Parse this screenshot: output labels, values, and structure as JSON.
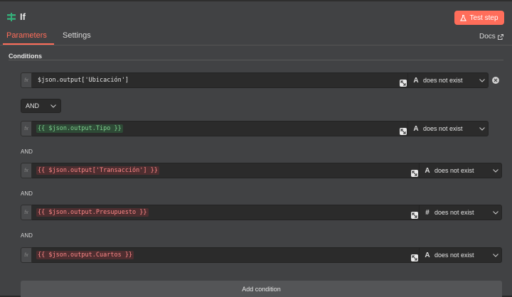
{
  "header": {
    "title": "If",
    "test_step_label": "Test step"
  },
  "tabs": [
    {
      "label": "Parameters",
      "active": true
    },
    {
      "label": "Settings",
      "active": false
    }
  ],
  "docs_label": "Docs",
  "section_title": "Conditions",
  "combinator": {
    "selected": "AND"
  },
  "and_label": "AND",
  "conditions": [
    {
      "expression": "$json.output['Ubicación']",
      "style": "plain",
      "type_icon": "A",
      "operator": "does not exist"
    },
    {
      "expression": "{{ $json.output.Tipo }}",
      "style": "resolved",
      "type_icon": "A",
      "operator": "does not exist"
    },
    {
      "expression": "{{ $json.output['Transacción'] }}",
      "style": "error",
      "type_icon": "A",
      "operator": "does not exist"
    },
    {
      "expression": "{{ $json.output.Presupuesto }}",
      "style": "error",
      "type_icon": "#",
      "operator": "does not exist"
    },
    {
      "expression": "{{ $json.output.Cuartos }}",
      "style": "error",
      "type_icon": "A",
      "operator": "does not exist"
    }
  ],
  "add_condition_label": "Add condition",
  "colors": {
    "accent": "#ff6d5a",
    "panel": "#414244",
    "input_bg": "#2b2b2b",
    "resolved_text": "#7fd18f",
    "error_text": "#ff8888"
  },
  "icons": [
    "if-node-icon",
    "flask-icon",
    "external-link-icon",
    "fx-icon",
    "mapping-icon",
    "chevron-down-icon",
    "remove-icon"
  ]
}
